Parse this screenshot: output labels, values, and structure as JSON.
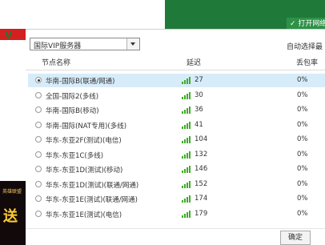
{
  "background": {
    "top_button_label": "打开网络",
    "ad_text": "英雄联盟",
    "ad_big": "送"
  },
  "popup": {
    "server_select": {
      "value": "国际VIP服务器"
    },
    "auto_select_label": "自动选择最",
    "columns": {
      "name": "节点名称",
      "latency": "延迟",
      "loss": "丢包率"
    },
    "rows": [
      {
        "name": "华南-国际B(联通/网通)",
        "latency": "27",
        "loss": "0%",
        "selected": true
      },
      {
        "name": "全国-国际2(多线)",
        "latency": "30",
        "loss": "0%",
        "selected": false
      },
      {
        "name": "华南-国际B(移动)",
        "latency": "36",
        "loss": "0%",
        "selected": false
      },
      {
        "name": "华南-国际(NAT专用)(多线)",
        "latency": "41",
        "loss": "0%",
        "selected": false
      },
      {
        "name": "华东-东亚2F(测试)(电信)",
        "latency": "104",
        "loss": "0%",
        "selected": false
      },
      {
        "name": "华东-东亚1C(多线)",
        "latency": "132",
        "loss": "0%",
        "selected": false
      },
      {
        "name": "华东-东亚1D(测试)(移动)",
        "latency": "146",
        "loss": "0%",
        "selected": false
      },
      {
        "name": "华东-东亚1D(测试)(联通/网通)",
        "latency": "152",
        "loss": "0%",
        "selected": false
      },
      {
        "name": "华东-东亚1E(测试)(联通/网通)",
        "latency": "174",
        "loss": "0%",
        "selected": false
      },
      {
        "name": "华东-东亚1E(测试)(电信)",
        "latency": "179",
        "loss": "0%",
        "selected": false
      }
    ],
    "confirm_label": "确定"
  },
  "colors": {
    "signal": "#3dad25",
    "selected_row": "#d7ecf9",
    "accent_green": "#1f7a3a"
  }
}
